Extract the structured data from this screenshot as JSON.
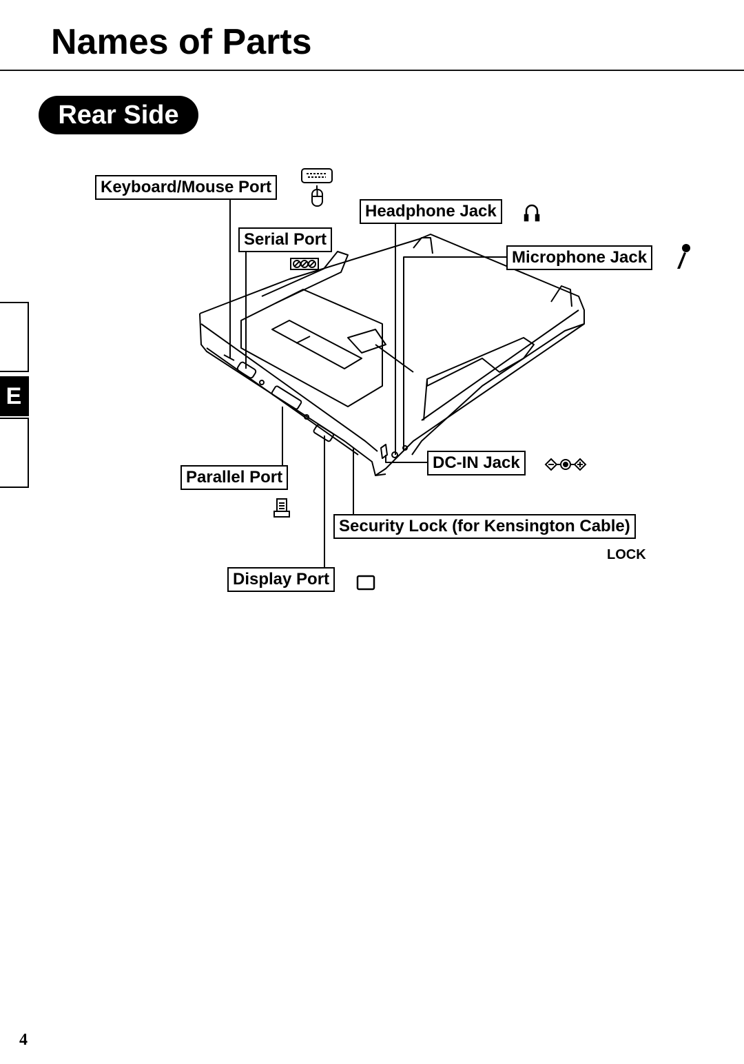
{
  "page": {
    "title": "Names of Parts",
    "section_badge": "Rear Side",
    "language_tab": "E",
    "page_number": "4"
  },
  "parts": {
    "keyboard_mouse_port": {
      "label": "Keyboard/Mouse Port",
      "icon": "keyboard-mouse-icon"
    },
    "serial_port": {
      "label": "Serial Port",
      "icon": "serial-port-icon"
    },
    "headphone_jack": {
      "label": "Headphone Jack",
      "icon": "headphone-icon"
    },
    "microphone_jack": {
      "label": "Microphone Jack",
      "icon": "microphone-icon"
    },
    "dc_in_jack": {
      "label": "DC-IN Jack",
      "icon": "dc-polarity-icon"
    },
    "parallel_port": {
      "label": "Parallel Port",
      "icon": "printer-icon"
    },
    "security_lock": {
      "label": "Security Lock (for Kensington Cable)",
      "icon_text": "LOCK"
    },
    "display_port": {
      "label": "Display Port",
      "icon": "monitor-icon"
    }
  }
}
